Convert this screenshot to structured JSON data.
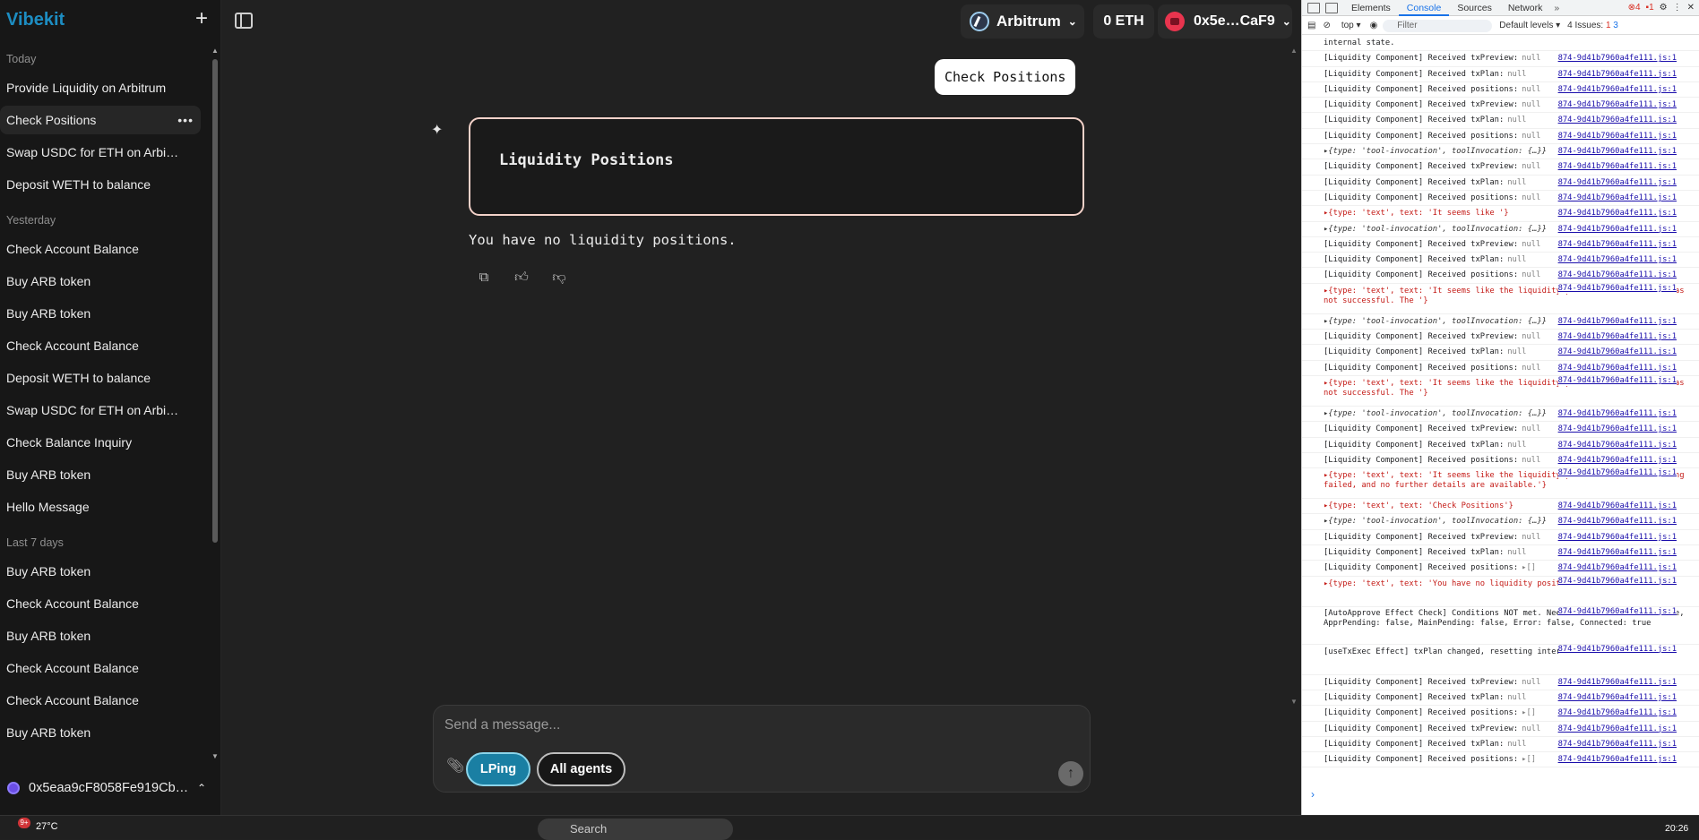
{
  "sidebar": {
    "brand": "Vibekit",
    "new_chat_icon": "plus-icon",
    "groups": [
      {
        "title": "Today",
        "items": [
          "Provide Liquidity on Arbitrum",
          "Check Positions",
          "Swap USDC for ETH on Arbi…",
          "Deposit WETH to balance"
        ]
      },
      {
        "title": "Yesterday",
        "items": [
          "Check Account Balance",
          "Buy ARB token",
          "Buy ARB token",
          "Check Account Balance",
          "Deposit WETH to balance",
          "Swap USDC for ETH on Arbi…",
          "Check Balance Inquiry",
          "Buy ARB token",
          "Hello Message"
        ]
      },
      {
        "title": "Last 7 days",
        "items": [
          "Buy ARB token",
          "Check Account Balance",
          "Buy ARB token",
          "Check Account Balance",
          "Check Account Balance",
          "Buy ARB token"
        ]
      }
    ],
    "active_item": "Check Positions",
    "wallet_address": "0x5eaa9cF8058Fe919Cb…"
  },
  "header": {
    "chain": "Arbitrum",
    "balance": "0 ETH",
    "account": "0x5e…CaF9"
  },
  "chat": {
    "user_message": "Check Positions",
    "card_title": "Liquidity Positions",
    "bot_text": "You have no liquidity positions."
  },
  "composer": {
    "placeholder": "Send a message...",
    "agent_pill": "LPing",
    "all_agents": "All agents"
  },
  "devtools": {
    "tabs": [
      "Elements",
      "Console",
      "Sources",
      "Network"
    ],
    "active_tab": "Console",
    "error_count": "4",
    "warn_count": "1",
    "context": "top",
    "filter_placeholder": "Filter",
    "levels": "Default levels",
    "issues": "4 Issues:",
    "issues_err": "1",
    "issues_info": "3",
    "source_ref": "874-9d41b7960a4fe111.js:1",
    "lines": [
      {
        "t": "internal state.",
        "k": "plain"
      },
      {
        "t": "[Liquidity Component] Received txPreview:",
        "v": "null",
        "k": "log"
      },
      {
        "t": "[Liquidity Component] Received txPlan:",
        "v": "null",
        "k": "log"
      },
      {
        "t": "[Liquidity Component] Received positions:",
        "v": "null",
        "k": "log"
      },
      {
        "t": "[Liquidity Component] Received txPreview:",
        "v": "null",
        "k": "log"
      },
      {
        "t": "[Liquidity Component] Received txPlan:",
        "v": "null",
        "k": "log"
      },
      {
        "t": "[Liquidity Component] Received positions:",
        "v": "null",
        "k": "log"
      },
      {
        "t": "▸{type: 'tool-invocation', toolInvocation: {…}}",
        "k": "obj"
      },
      {
        "t": "[Liquidity Component] Received txPreview:",
        "v": "null",
        "k": "log"
      },
      {
        "t": "[Liquidity Component] Received txPlan:",
        "v": "null",
        "k": "log"
      },
      {
        "t": "[Liquidity Component] Received positions:",
        "v": "null",
        "k": "log"
      },
      {
        "t": "▸{type: 'text', text: 'It seems like '}",
        "k": "obj"
      },
      {
        "t": "▸{type: 'tool-invocation', toolInvocation: {…}}",
        "k": "obj"
      },
      {
        "t": "[Liquidity Component] Received txPreview:",
        "v": "null",
        "k": "log"
      },
      {
        "t": "[Liquidity Component] Received txPlan:",
        "v": "null",
        "k": "log"
      },
      {
        "t": "[Liquidity Component] Received positions:",
        "v": "null",
        "k": "log"
      },
      {
        "t": "▸{type: 'text', text: 'It seems like the liquidity provision on Arbitrum was not successful. The '}",
        "k": "objtall"
      },
      {
        "t": "▸{type: 'tool-invocation', toolInvocation: {…}}",
        "k": "obj"
      },
      {
        "t": "[Liquidity Component] Received txPreview:",
        "v": "null",
        "k": "log"
      },
      {
        "t": "[Liquidity Component] Received txPlan:",
        "v": "null",
        "k": "log"
      },
      {
        "t": "[Liquidity Component] Received positions:",
        "v": "null",
        "k": "log"
      },
      {
        "t": "▸{type: 'text', text: 'It seems like the liquidity provision on Arbitrum was not successful. The '}",
        "k": "objtall"
      },
      {
        "t": "▸{type: 'tool-invocation', toolInvocation: {…}}",
        "k": "obj"
      },
      {
        "t": "[Liquidity Component] Received txPreview:",
        "v": "null",
        "k": "log"
      },
      {
        "t": "[Liquidity Component] Received txPlan:",
        "v": "null",
        "k": "log"
      },
      {
        "t": "[Liquidity Component] Received positions:",
        "v": "null",
        "k": "log"
      },
      {
        "t": "▸{type: 'text', text: 'It seems like the liquidity provision on Arbitrum ing failed, and no further details are available.'}",
        "k": "objtall"
      },
      {
        "t": "▸{type: 'text', text: 'Check Positions'}",
        "k": "obj"
      },
      {
        "t": "▸{type: 'tool-invocation', toolInvocation: {…}}",
        "k": "obj"
      },
      {
        "t": "[Liquidity Component] Received txPreview:",
        "v": "null",
        "k": "log"
      },
      {
        "t": "[Liquidity Component] Received txPlan:",
        "v": "null",
        "k": "log"
      },
      {
        "t": "[Liquidity Component] Received positions:",
        "v": "▸[]",
        "k": "log"
      },
      {
        "t": "▸{type: 'text', text: 'You have no liquidity positions.'}",
        "k": "objtall"
      },
      {
        "t": "[AutoApprove Effect Check] Conditions NOT met. Needs: false, Complete: true, ApprPending: false, MainPending: false, Error: false, Connected: true",
        "k": "multi"
      },
      {
        "t": "[useTxExec Effect] txPlan changed, resetting internal state.",
        "k": "tall"
      },
      {
        "t": "[Liquidity Component] Received txPreview:",
        "v": "null",
        "k": "log"
      },
      {
        "t": "[Liquidity Component] Received txPlan:",
        "v": "null",
        "k": "log"
      },
      {
        "t": "[Liquidity Component] Received positions:",
        "v": "▸[]",
        "k": "log"
      },
      {
        "t": "[Liquidity Component] Received txPreview:",
        "v": "null",
        "k": "log"
      },
      {
        "t": "[Liquidity Component] Received txPlan:",
        "v": "null",
        "k": "log"
      },
      {
        "t": "[Liquidity Component] Received positions:",
        "v": "▸[]",
        "k": "log"
      }
    ]
  },
  "taskbar": {
    "temperature": "27°C",
    "weather_badge": "9+",
    "search": "Search",
    "clock": "20:26"
  }
}
